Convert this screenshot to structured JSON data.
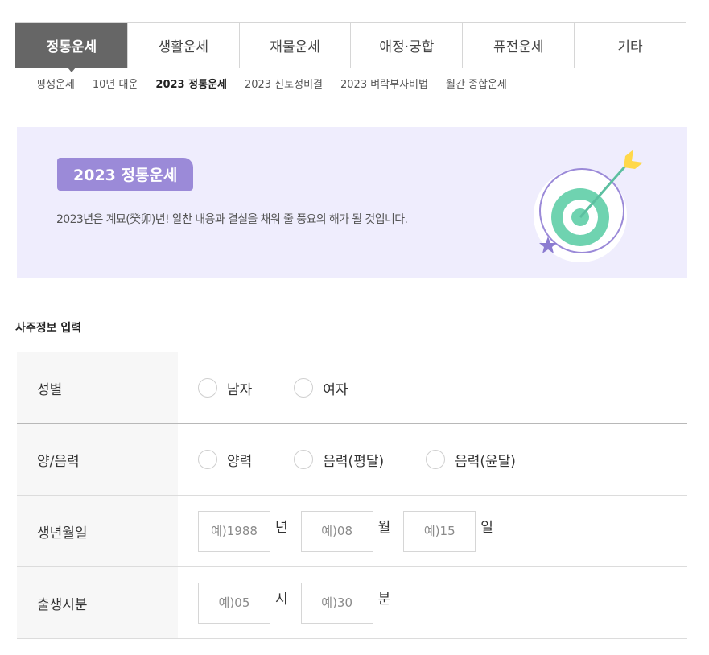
{
  "main_tabs": [
    {
      "label": "정통운세",
      "active": true
    },
    {
      "label": "생활운세",
      "active": false
    },
    {
      "label": "재물운세",
      "active": false
    },
    {
      "label": "애정·궁합",
      "active": false
    },
    {
      "label": "퓨전운세",
      "active": false
    },
    {
      "label": "기타",
      "active": false
    }
  ],
  "sub_tabs": [
    {
      "label": "평생운세",
      "active": false
    },
    {
      "label": "10년 대운",
      "active": false
    },
    {
      "label": "2023 정통운세",
      "active": true
    },
    {
      "label": "2023 신토정비결",
      "active": false
    },
    {
      "label": "2023 벼락부자비법",
      "active": false
    },
    {
      "label": "월간 종합운세",
      "active": false
    }
  ],
  "banner": {
    "badge": "2023 정통운세",
    "description": "2023년은 계묘(癸卯)년! 알찬 내용과 결실을 채워 줄 풍요의 해가 될 것입니다.",
    "background_color": "#efedfd",
    "badge_color": "#9b8ad8",
    "illustration_icon": "target-arrow-icon"
  },
  "section_title": "사주정보 입력",
  "form": {
    "gender": {
      "label": "성별",
      "options": [
        "남자",
        "여자"
      ]
    },
    "calendar": {
      "label": "양/음력",
      "options": [
        "양력",
        "음력(평달)",
        "음력(윤달)"
      ]
    },
    "birthdate": {
      "label": "생년월일",
      "year_placeholder": "예)1988",
      "year_unit": "년",
      "month_placeholder": "예)08",
      "month_unit": "월",
      "day_placeholder": "예)15",
      "day_unit": "일"
    },
    "birthtime": {
      "label": "출생시분",
      "hour_placeholder": "예)05",
      "hour_unit": "시",
      "minute_placeholder": "예)30",
      "minute_unit": "분"
    }
  }
}
